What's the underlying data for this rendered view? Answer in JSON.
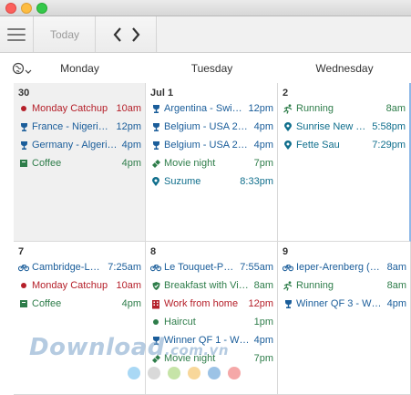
{
  "window": {
    "traffic_lights": [
      "close",
      "minimize",
      "zoom"
    ]
  },
  "toolbar": {
    "menu_icon": "hamburger-icon",
    "today_label": "Today",
    "prev_icon": "chevron-left-icon",
    "next_icon": "chevron-right-icon"
  },
  "header": {
    "timezone_icon": "globe-icon",
    "days": [
      "Monday",
      "Tuesday",
      "Wednesday"
    ]
  },
  "colors": {
    "red": "#b5202a",
    "blue": "#1a5d9a",
    "green": "#2e7d4a",
    "teal": "#0f6e8c"
  },
  "weeks": [
    {
      "days": [
        {
          "num": "30",
          "past": true,
          "events": [
            {
              "icon": "dot-icon",
              "color": "red",
              "title": "Monday Catchup",
              "time": "10am"
            },
            {
              "icon": "trophy-icon",
              "color": "blue",
              "title": "France - Nigeria 2...",
              "time": "12pm"
            },
            {
              "icon": "trophy-icon",
              "color": "blue",
              "title": "Germany - Algeria ...",
              "time": "4pm"
            },
            {
              "icon": "square-icon",
              "color": "green",
              "title": "Coffee",
              "time": "4pm"
            }
          ]
        },
        {
          "num": "Jul 1",
          "past": false,
          "events": [
            {
              "icon": "trophy-icon",
              "color": "blue",
              "title": "Argentina - Switz...",
              "time": "12pm"
            },
            {
              "icon": "trophy-icon",
              "color": "blue",
              "title": "Belgium - USA 2:1 ...",
              "time": "4pm"
            },
            {
              "icon": "trophy-icon",
              "color": "blue",
              "title": "Belgium - USA 2:1 ...",
              "time": "4pm"
            },
            {
              "icon": "ticket-icon",
              "color": "green",
              "title": "Movie night",
              "time": "7pm"
            },
            {
              "icon": "pin-icon",
              "color": "teal",
              "title": "Suzume",
              "time": "8:33pm"
            }
          ]
        },
        {
          "num": "2",
          "past": false,
          "events": [
            {
              "icon": "runner-icon",
              "color": "green",
              "title": "Running",
              "time": "8am"
            },
            {
              "icon": "pin-icon",
              "color": "teal",
              "title": "Sunrise New York",
              "time": "5:58pm"
            },
            {
              "icon": "pin-icon",
              "color": "teal",
              "title": "Fette Sau",
              "time": "7:29pm"
            }
          ]
        }
      ]
    },
    {
      "days": [
        {
          "num": "7",
          "past": false,
          "events": [
            {
              "icon": "bike-icon",
              "color": "blue",
              "title": "Cambridge-Lon...",
              "time": "7:25am"
            },
            {
              "icon": "dot-icon",
              "color": "red",
              "title": "Monday Catchup",
              "time": "10am"
            },
            {
              "icon": "square-icon",
              "color": "green",
              "title": "Coffee",
              "time": "4pm"
            }
          ]
        },
        {
          "num": "8",
          "past": false,
          "events": [
            {
              "icon": "bike-icon",
              "color": "blue",
              "title": "Le Touquet-Pari...",
              "time": "7:55am"
            },
            {
              "icon": "shield-icon",
              "color": "green",
              "title": "Breakfast with Victor",
              "time": "8am"
            },
            {
              "icon": "building-icon",
              "color": "red",
              "title": "Work from home",
              "time": "12pm"
            },
            {
              "icon": "dot-icon",
              "color": "green",
              "title": "Haircut",
              "time": "1pm"
            },
            {
              "icon": "trophy-icon",
              "color": "blue",
              "title": "Winner QF 1 - Win...",
              "time": "4pm"
            },
            {
              "icon": "ticket-icon",
              "color": "green",
              "title": "Movie night",
              "time": "7pm"
            }
          ]
        },
        {
          "num": "9",
          "past": false,
          "events": [
            {
              "icon": "bike-icon",
              "color": "blue",
              "title": "Ieper-Arenberg (St...",
              "time": "8am"
            },
            {
              "icon": "runner-icon",
              "color": "green",
              "title": "Running",
              "time": "8am"
            },
            {
              "icon": "trophy-icon",
              "color": "blue",
              "title": "Winner QF 3 - Win...",
              "time": "4pm"
            }
          ]
        }
      ]
    }
  ],
  "watermark": {
    "brand": "Download",
    "suffix": ".com.vn",
    "dot_colors": [
      "#a9d8f5",
      "#d9d9d9",
      "#c6e4a8",
      "#f8d79a",
      "#9cc3e6",
      "#f5a8a8"
    ]
  }
}
